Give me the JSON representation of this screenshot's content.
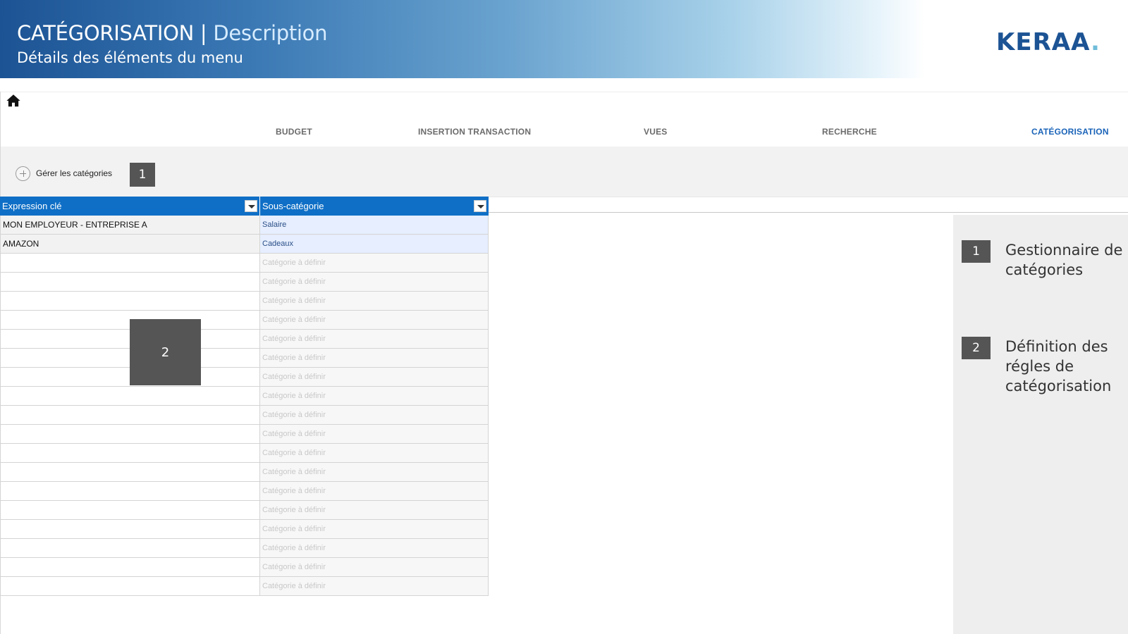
{
  "banner": {
    "title_main": "CATÉGORISATION",
    "title_sep": " | ",
    "title_accent": "Description",
    "subtitle": "Détails des éléments du menu",
    "logo_text": "KERAA",
    "logo_dot": "."
  },
  "nav": {
    "home_icon": "home-icon",
    "items": [
      {
        "label": "BUDGET",
        "active": false
      },
      {
        "label": "INSERTION TRANSACTION",
        "active": false
      },
      {
        "label": "VUES",
        "active": false
      },
      {
        "label": "RECHERCHE",
        "active": false
      },
      {
        "label": "CATÉGORISATION",
        "active": true
      }
    ]
  },
  "toolbar": {
    "manage_label": "Gérer les catégories",
    "manage_icon": "plus-circle-icon"
  },
  "markers": {
    "m1": "1",
    "m2": "2"
  },
  "table": {
    "columns": [
      "Expression clé",
      "Sous-catégorie"
    ],
    "rows": [
      {
        "expression": "MON EMPLOYEUR - ENTREPRISE A",
        "subcategory": "Salaire"
      },
      {
        "expression": "AMAZON",
        "subcategory": "Cadeaux"
      },
      {
        "expression": "",
        "subcategory": "Catégorie à définir"
      },
      {
        "expression": "",
        "subcategory": "Catégorie à définir"
      },
      {
        "expression": "",
        "subcategory": "Catégorie à définir"
      },
      {
        "expression": "",
        "subcategory": "Catégorie à définir"
      },
      {
        "expression": "",
        "subcategory": "Catégorie à définir"
      },
      {
        "expression": "",
        "subcategory": "Catégorie à définir"
      },
      {
        "expression": "",
        "subcategory": "Catégorie à définir"
      },
      {
        "expression": "",
        "subcategory": "Catégorie à définir"
      },
      {
        "expression": "",
        "subcategory": "Catégorie à définir"
      },
      {
        "expression": "",
        "subcategory": "Catégorie à définir"
      },
      {
        "expression": "",
        "subcategory": "Catégorie à définir"
      },
      {
        "expression": "",
        "subcategory": "Catégorie à définir"
      },
      {
        "expression": "",
        "subcategory": "Catégorie à définir"
      },
      {
        "expression": "",
        "subcategory": "Catégorie à définir"
      },
      {
        "expression": "",
        "subcategory": "Catégorie à définir"
      },
      {
        "expression": "",
        "subcategory": "Catégorie à définir"
      },
      {
        "expression": "",
        "subcategory": "Catégorie à définir"
      },
      {
        "expression": "",
        "subcategory": "Catégorie à définir"
      }
    ]
  },
  "legend": [
    {
      "number": "1",
      "text": "Gestionnaire de catégories"
    },
    {
      "number": "2",
      "text": "Définition des régles de catégorisation"
    }
  ],
  "colors": {
    "header_blue": "#0f6fc6",
    "active_nav": "#1a63b8",
    "marker_gray": "#555555"
  }
}
